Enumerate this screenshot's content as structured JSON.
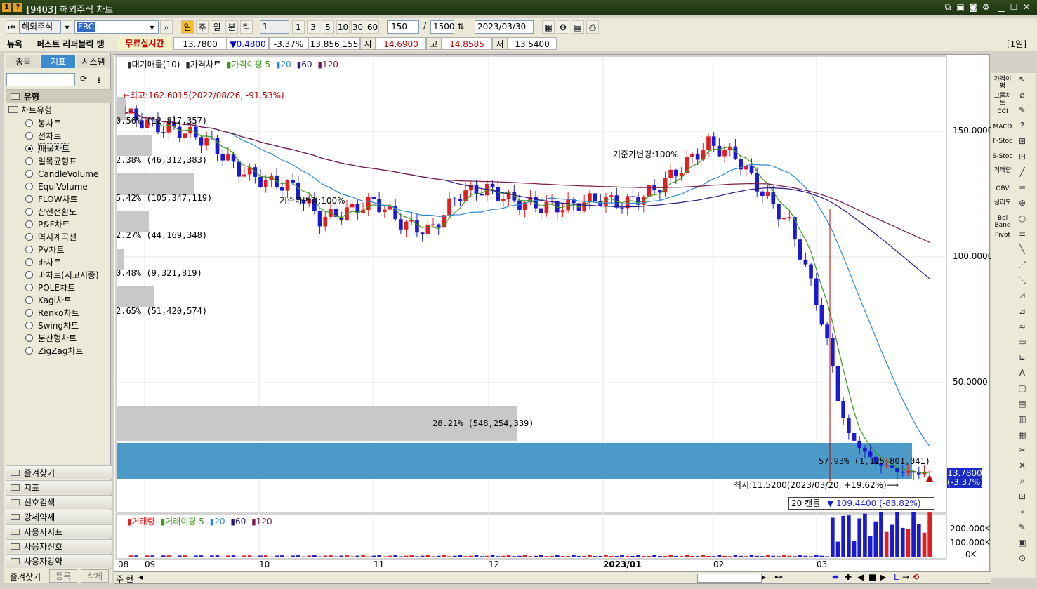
{
  "window": {
    "title": "[9403] 해외주식 차트",
    "badges": [
      "1",
      "?"
    ]
  },
  "toolbar": {
    "market": "해외주식",
    "symbol": "FRC",
    "periods": [
      "일",
      "주",
      "월",
      "분",
      "틱"
    ],
    "interval_value": "1",
    "quick_intervals": [
      "1",
      "3",
      "5",
      "10",
      "30",
      "60"
    ],
    "count": "150",
    "slash": "/",
    "max_count": "1500",
    "date": "2023/03/30"
  },
  "quote": {
    "news": "뉴욕",
    "name": "퍼스트 리퍼블릭 뱅",
    "realtime": "무료실시간",
    "price": "13.7800",
    "change": "▼0.4800",
    "change_pct": "-3.37%",
    "volume": "13,856,155",
    "open_label": "시",
    "open": "14.6900",
    "high_label": "고",
    "high": "14.8585",
    "low_label": "저",
    "low": "13.5400",
    "period_tag": "[1일]"
  },
  "left": {
    "tabs": [
      "종목",
      "지표",
      "시스템"
    ],
    "section": "유형",
    "group": "차트유형",
    "types": [
      "봉차트",
      "선차트",
      "매물차트",
      "일목균형표",
      "CandleVolume",
      "EquiVolume",
      "FLOW차트",
      "삼선전환도",
      "P&F차트",
      "역시계곡선",
      "PV차트",
      "바차트",
      "바차트(시고저종)",
      "POLE차트",
      "Kagi차트",
      "Renko차트",
      "Swing차트",
      "분산형차트",
      "ZigZag차트"
    ],
    "selected": "매물차트",
    "categories": [
      "즐겨찾기",
      "지표",
      "신호검색",
      "강세약세",
      "사용자지표",
      "사용자신호",
      "사용자강약"
    ],
    "bottom": [
      "즐겨찾기",
      "등록",
      "삭제"
    ]
  },
  "chart": {
    "legend": [
      "대기매물(10)",
      "가격차트",
      "가격이평",
      "5",
      "20",
      "60",
      "120"
    ],
    "y_ticks": [
      "150.0000",
      "100.0000",
      "50.0000"
    ],
    "x_labels": [
      "08",
      "09",
      "10",
      "11",
      "12",
      "2023/01",
      "02",
      "03"
    ],
    "high_annotation": "←최고:162.6015(2022/08/26, -91.53%)",
    "low_annotation": "최저:11.5200(2023/03/20, +19.62%)⟶",
    "base_change": "기준가변경:100%",
    "profile": [
      {
        "label": "0.56% (12,817,357)"
      },
      {
        "label": "2.38% (46,312,383)"
      },
      {
        "label": "5.42% (105,347,119)"
      },
      {
        "label": "2.27% (44,169,348)"
      },
      {
        "label": "0.48% (9,321,819)"
      },
      {
        "label": "2.65% (51,420,574)"
      },
      {
        "label": "28.21% (548,254,339)"
      },
      {
        "label": "57.93% (1,125,801,041)"
      }
    ],
    "current_price": "13.7800",
    "current_change": "(-3.37%)",
    "candle_info": "20 캔들",
    "candle_change": "▼ 109.4400 (-88.82%)",
    "volume_legend": [
      "거래량",
      "거래이평",
      "5",
      "20",
      "60",
      "120"
    ],
    "volume_ticks": [
      "200,000K",
      "100,000K",
      "0K"
    ],
    "colors": {
      "up": "#e02020",
      "down": "#1a1ad0",
      "ma5": "#3d9a1a",
      "ma20": "#2a8ad8",
      "ma60": "#2a1a80",
      "ma120": "#7a1a50",
      "profile": "#c8c8c8",
      "profile_hi": "#4b9ac8"
    }
  },
  "right_tools": [
    "가격이평",
    "그물차트",
    "CCI",
    "MACD",
    "F-Stoc",
    "S-Stoc",
    "거래량",
    "OBV",
    "심리도",
    "Bol Band",
    "Pivot"
  ],
  "statusbar": {
    "left": [
      "주",
      "현"
    ]
  },
  "chart_data": {
    "type": "candlestick",
    "x_axis": [
      "08",
      "09",
      "10",
      "11",
      "12",
      "2023/01",
      "02",
      "03"
    ],
    "ylim": [
      0,
      165
    ],
    "approx_close": [
      157,
      152,
      150,
      146,
      135,
      130,
      128,
      115,
      118,
      122,
      113,
      110,
      125,
      127,
      122,
      120,
      120,
      123,
      121,
      126,
      135,
      145,
      140,
      125,
      112,
      80,
      30,
      18,
      14,
      13.78
    ],
    "profile_pct": [
      0.56,
      2.38,
      5.42,
      2.27,
      0.48,
      2.65,
      28.21,
      57.93
    ]
  }
}
